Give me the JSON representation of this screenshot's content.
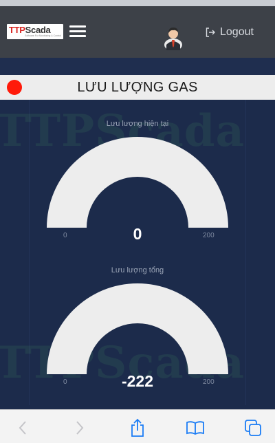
{
  "header": {
    "logo": {
      "brand_red": "TTP",
      "brand_dark": "Scada",
      "tagline": "Software For Monitoring & Control"
    },
    "menu_icon": "hamburger-icon",
    "user_icon": "user-avatar-icon",
    "logout_label": "Logout"
  },
  "panel": {
    "title": "LƯU LƯỢNG GAS",
    "status_color": "#ff1a0a"
  },
  "watermark_text": "TTPScada",
  "gauges": [
    {
      "label": "Lưu lượng hiện tại",
      "value": "0",
      "min": "0",
      "max": "200",
      "fraction": 0.0
    },
    {
      "label": "Lưu lượng tổng",
      "value": "-222",
      "min": "0",
      "max": "200",
      "fraction": 0.0
    }
  ],
  "toolbar": {
    "back_icon": "chevron-left-icon",
    "forward_icon": "chevron-right-icon",
    "share_icon": "share-icon",
    "bookmarks_icon": "book-icon",
    "tabs_icon": "tabs-icon"
  },
  "colors": {
    "header_bg": "#3d4148",
    "content_bg": "#1c2b4b",
    "gauge_track": "#ededed",
    "accent_blue": "#1a7cf5"
  }
}
